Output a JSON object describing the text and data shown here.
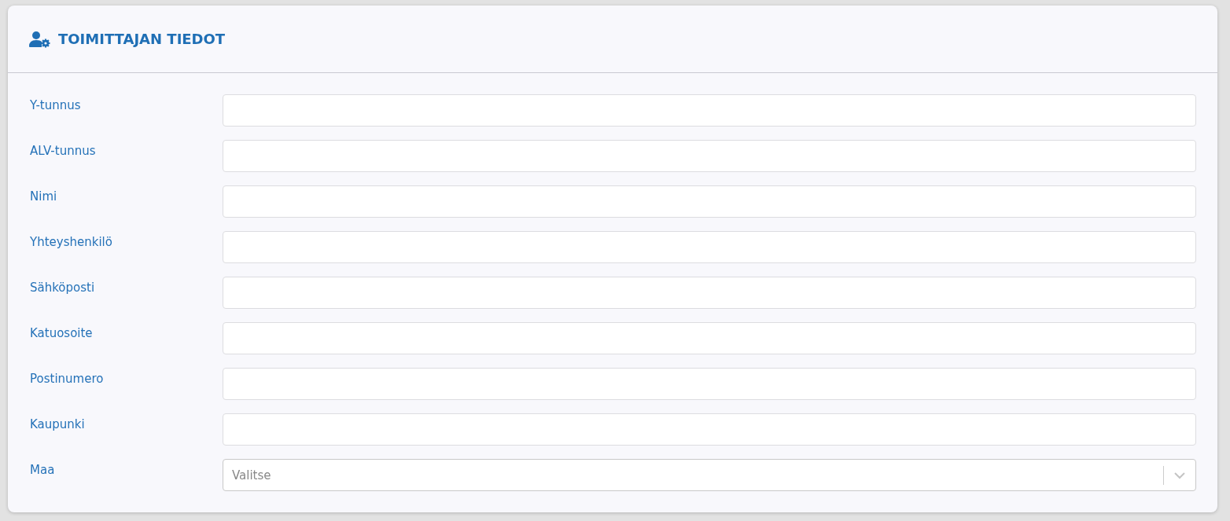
{
  "panel": {
    "title": "TOIMITTAJAN TIEDOT"
  },
  "fields": [
    {
      "kind": "text",
      "label": "Y-tunnus"
    },
    {
      "kind": "text",
      "label": "ALV-tunnus"
    },
    {
      "kind": "text",
      "label": "Nimi"
    },
    {
      "kind": "text",
      "label": "Yhteyshenkilö"
    },
    {
      "kind": "text",
      "label": "Sähköposti"
    },
    {
      "kind": "text",
      "label": "Katuosoite"
    },
    {
      "kind": "text",
      "label": "Postinumero"
    },
    {
      "kind": "text",
      "label": "Kaupunki"
    },
    {
      "kind": "select",
      "label": "Maa",
      "placeholder": "Valitse"
    }
  ]
}
